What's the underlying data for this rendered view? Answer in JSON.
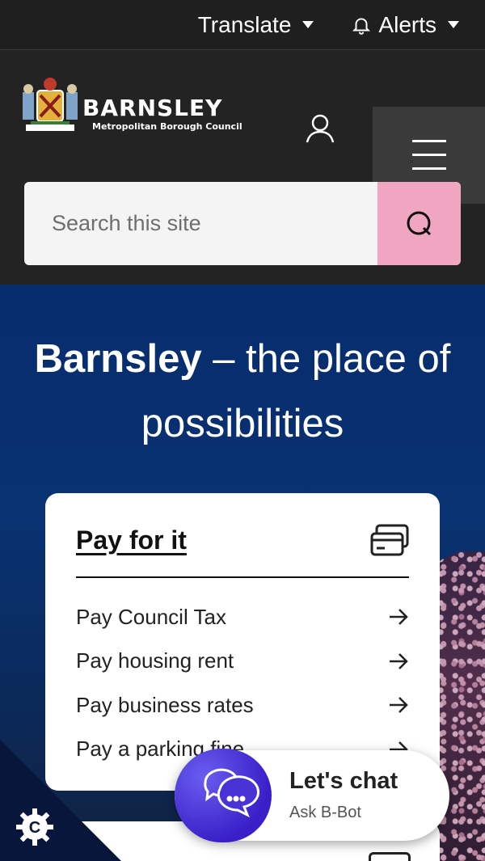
{
  "topbar": {
    "translate_label": "Translate",
    "alerts_label": "Alerts"
  },
  "header": {
    "logo_name": "BARNSLEY",
    "logo_subtitle": "Metropolitan Borough Council",
    "account_icon": "user-icon",
    "menu_icon": "hamburger-menu-icon"
  },
  "search": {
    "placeholder": "Search this site",
    "button_icon": "search-icon",
    "button_color": "#f0a6c0"
  },
  "hero": {
    "headline_bold": "Barnsley",
    "headline_rest": " – the place of possibilities"
  },
  "pay_card": {
    "title": "Pay for it",
    "icon": "credit-card-icon",
    "links": [
      {
        "label": "Pay Council Tax"
      },
      {
        "label": "Pay housing rent"
      },
      {
        "label": "Pay business rates"
      },
      {
        "label": "Pay a parking fine"
      }
    ]
  },
  "chat": {
    "title": "Let's chat",
    "subtitle": "Ask B-Bot",
    "icon": "chat-bubbles-icon"
  },
  "cookie": {
    "icon": "cookie-settings-icon"
  },
  "colors": {
    "header_bg": "#232323",
    "hero_bg": "#062d6e",
    "accent_pink": "#f0a6c0"
  }
}
